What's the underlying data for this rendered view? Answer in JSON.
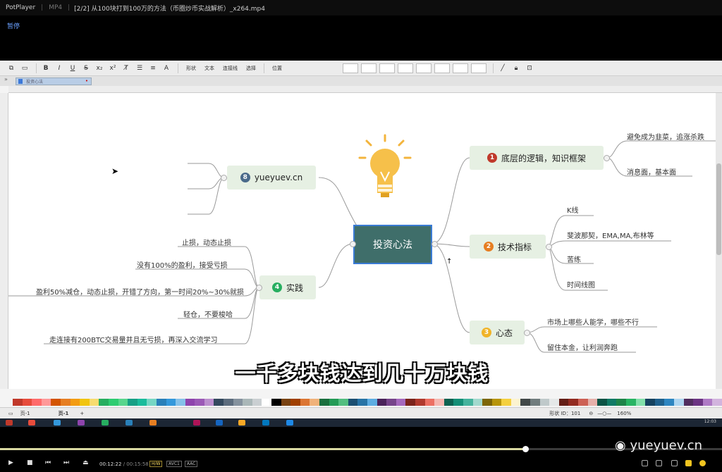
{
  "player": {
    "app_name": "PotPlayer",
    "format": "MP4",
    "file_title": "[2/2] 从100块打到100万的方法（币圈炒币实战解析）_x264.mp4",
    "osd_status": "暂停",
    "current_time": "00:12:22",
    "total_time": "00:15:58",
    "tag_hw": "H/W",
    "tag_avc": "AVC1",
    "tag_aac": "AAC",
    "progress_fraction": 0.728,
    "watermark": "yueyuev.cn"
  },
  "app": {
    "toolbar_labels": [
      "形状",
      "文本",
      "连接线",
      "选择",
      "位置"
    ],
    "tab_title": "投资心法",
    "status_page_left": "页-1",
    "status_page_tab": "页-1",
    "shape_id": "形状 ID：101",
    "zoom": "160%",
    "clock": "12:03"
  },
  "mindmap": {
    "central": "投资心法",
    "topics": [
      {
        "num": "1",
        "label": "底层的逻辑，知识框架",
        "leaves": [
          "避免成为韭菜，追涨杀跌",
          "消息面，基本面"
        ]
      },
      {
        "num": "2",
        "label": "技术指标",
        "leaves": [
          "K线",
          "斐波那契，EMA,MA,布林等",
          "苦练",
          "时间线图"
        ]
      },
      {
        "num": "3",
        "label": "心态",
        "leaves": [
          "市场上哪些人能学，哪些不行",
          "留住本金，让利润奔跑"
        ]
      },
      {
        "num": "4",
        "label": "实践",
        "leaves": [
          "止损，动态止损",
          "没有100%的盈利，接受亏损",
          "盈利50%减仓，动态止损，开错了方向，第一时间20%~30%就损",
          "轻仓，不要梭哈",
          "走连接有200BTC交易量并且无亏损，再深入交流学习"
        ]
      },
      {
        "num": "8",
        "label": "yueyuev.cn",
        "leaves": []
      }
    ]
  },
  "subtitle": "一千多块钱达到几十万块钱",
  "colors": {
    "central_fill": "#3f6e6a",
    "topic_fill": "#e6f0e3",
    "selection_border": "#3a7bd5",
    "badge_1": "#c0392b",
    "badge_2": "#e67e22",
    "badge_3": "#f0b429",
    "badge_4": "#27ae60",
    "badge_8": "#4a6a8a"
  },
  "icons": [
    "lightbulb-icon",
    "play-icon",
    "stop-icon",
    "prev-icon",
    "next-icon",
    "eject-icon"
  ]
}
